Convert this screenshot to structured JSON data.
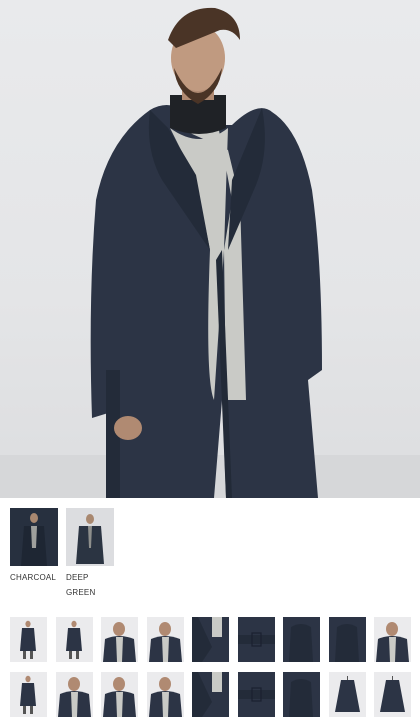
{
  "product": {
    "colors": [
      {
        "label": "CHARCOAL",
        "swatch": "#243044",
        "bg": "#2e3a4d"
      },
      {
        "label": "DEEP GREEN",
        "swatch": "#2b3442",
        "bg": "#d9dadc"
      }
    ],
    "coat_color": "#2c3445",
    "sweater_color": "#c9cac6",
    "trouser_color": "#56575a",
    "thumbnails": [
      {
        "view": "full-front",
        "bg": "#ebebed"
      },
      {
        "view": "walking",
        "bg": "#ebebed"
      },
      {
        "view": "turtleneck-front",
        "bg": "#ebebed"
      },
      {
        "view": "profile",
        "bg": "#ebebed"
      },
      {
        "view": "collar-detail",
        "bg": "#2c3445"
      },
      {
        "view": "belt-detail",
        "bg": "#2c3445"
      },
      {
        "view": "pocket-detail",
        "bg": "#2c3445"
      },
      {
        "view": "coat-flat",
        "bg": "#2c3445"
      },
      {
        "view": "full-back",
        "bg": "#ebebed"
      },
      {
        "view": "walking-side",
        "bg": "#ebebed"
      },
      {
        "view": "three-quarter",
        "bg": "#ebebed"
      },
      {
        "view": "back",
        "bg": "#ebebed"
      },
      {
        "view": "face-detail",
        "bg": "#ebebed"
      },
      {
        "view": "lapel-detail",
        "bg": "#2c3445"
      },
      {
        "view": "belt-close",
        "bg": "#2c3445"
      },
      {
        "view": "sleeve-detail",
        "bg": "#2c3445"
      },
      {
        "view": "coat-hanging",
        "bg": "#ebebed"
      },
      {
        "view": "coat-back-flat",
        "bg": "#ebebed"
      }
    ]
  }
}
